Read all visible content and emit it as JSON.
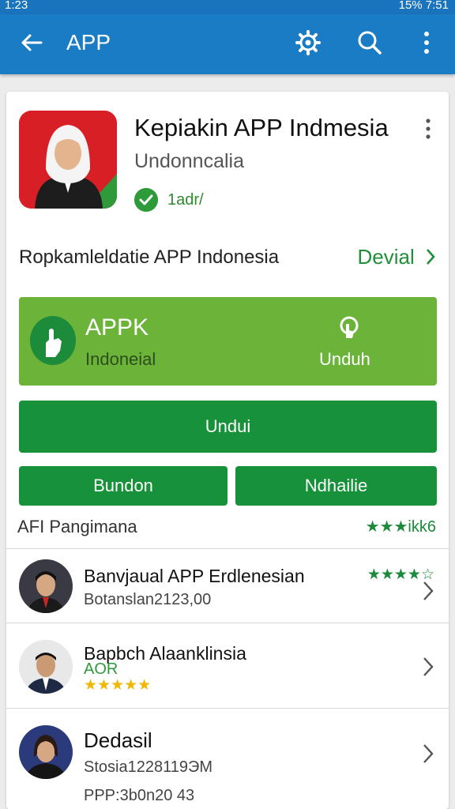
{
  "status": {
    "left": "1:23",
    "right": "15% 7:51"
  },
  "appbar": {
    "title": "APP"
  },
  "app": {
    "name": "Kepiakin APP Indmesia",
    "sub": "Undonncalia",
    "verified_label": "1adr/"
  },
  "dev_row": {
    "label": "Ropkamleldatie APP Indonesia",
    "link": "Devial"
  },
  "promo": {
    "title": "APPK",
    "sub": "Indoneial",
    "download_label": "Unduh"
  },
  "buttons": {
    "main": "Undui",
    "left": "Bundon",
    "right": "Ndhailie"
  },
  "section": {
    "label": "AFI Pangimana",
    "rating": "★★★ikk6"
  },
  "list": [
    {
      "title": "Banvjaual APP Erdlenesian",
      "sub": "Botanslan2123,00",
      "stars": "★★★★☆"
    },
    {
      "title": "Bapbch Alaanklinsia",
      "sub": "AOR",
      "stars": "★★★★★"
    },
    {
      "title": "Dedasil",
      "sub": "Stosia1228119ЭM",
      "sub2": "PPP:3b0n20 43"
    }
  ],
  "colors": {
    "appbar": "#1a7cc4",
    "primary_green": "#17913a",
    "promo_green": "#6cb33a",
    "star_yellow": "#f2b705"
  }
}
